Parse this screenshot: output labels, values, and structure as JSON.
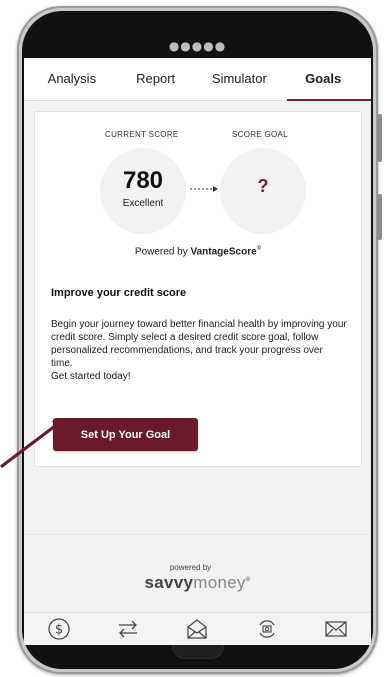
{
  "tabs": [
    "Analysis",
    "Report",
    "Simulator",
    "Goals"
  ],
  "active_tab": "Goals",
  "score": {
    "current_label": "CURRENT SCORE",
    "goal_label": "SCORE GOAL",
    "current_value": "780",
    "current_rating": "Excellent",
    "goal_value": "?",
    "powered_prefix": "Powered by ",
    "powered_brand": "VantageScore",
    "powered_mark": "®"
  },
  "improve": {
    "heading": "Improve your credit score",
    "desc_line": "Begin your journey toward better financial health by improving your credit score. Simply select a desired credit score goal, follow personalized recommendations, and track your progress over time.",
    "desc_cta": "Get started today!",
    "button": "Set Up Your Goal"
  },
  "footer": {
    "powered_by": "powered by",
    "brand_bold": "savvy",
    "brand_light": "money",
    "brand_mark": "®"
  },
  "bottom_icons": [
    "dollar-icon",
    "transfer-icon",
    "envelope-open-icon",
    "camera-sync-icon",
    "mail-icon"
  ],
  "colors": {
    "accent": "#7b1e33",
    "button": "#6b1a2b"
  }
}
